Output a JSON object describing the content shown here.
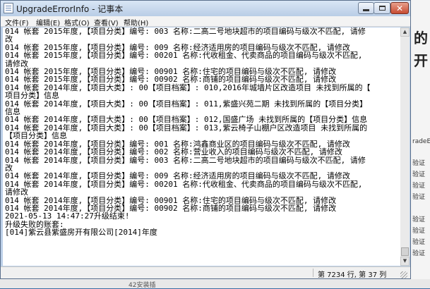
{
  "window": {
    "title": "UpgradeErrorInfo - 记事本"
  },
  "menu": [
    "文件(F)",
    "编辑(E)",
    "格式(O)",
    "查看(V)",
    "帮助(H)"
  ],
  "content_lines": [
    "014 帐套 2015年度,【项目分类】编号: 003 名称:二高二号地块超市的项目编码与级次不匹配, 请修",
    "改",
    "014 帐套 2015年度,【项目分类】编号: 009 名称:经济适用房的项目编码与级次不匹配, 请修改",
    "014 帐套 2015年度,【项目分类】编号: 00201 名称:代收租金、代卖商品的项目编码与级次不匹配,",
    "请修改",
    "014 帐套 2015年度,【项目分类】编号: 00901 名称:住宅的项目编码与级次不匹配, 请修改",
    "014 帐套 2015年度,【项目分类】编号: 00902 名称:商铺的项目编码与级次不匹配, 请修改",
    "014 帐套 2014年度,【项目大类】: 00【项目档案】: 010,2016年城墙片区改造项目 未找到所属的【",
    "项目分类】信息",
    "014 帐套 2014年度,【项目大类】: 00【项目档案】: 011,紫盛兴苑二期 未找到所属的【项目分类】",
    "信息",
    "014 帐套 2014年度,【项目大类】: 00【项目档案】: 012,国盛广场 未找到所属的【项目分类】信息",
    "014 帐套 2014年度,【项目大类】: 00【项目档案】: 013,紫云椅子山棚户区改造项目 未找到所属的",
    "【项目分类】信息",
    "014 帐套 2014年度,【项目分类】编号: 001 名称:鸿鑫商业区的项目编码与级次不匹配, 请修改",
    "014 帐套 2014年度,【项目分类】编号: 002 名称:营业收入的项目编码与级次不匹配, 请修改",
    "014 帐套 2014年度,【项目分类】编号: 003 名称:二高二号地块超市的项目编码与级次不匹配, 请修",
    "改",
    "014 帐套 2014年度,【项目分类】编号: 009 名称:经济适用房的项目编码与级次不匹配, 请修改",
    "014 帐套 2014年度,【项目分类】编号: 00201 名称:代收租金、代卖商品的项目编码与级次不匹配,",
    "请修改",
    "014 帐套 2014年度,【项目分类】编号: 00901 名称:住宅的项目编码与级次不匹配, 请修改",
    "014 帐套 2014年度,【项目分类】编号: 00902 名称:商铺的项目编码与级次不匹配, 请修改",
    "",
    "2021-05-13 14:47:27升级结束!",
    "升级失败的账套:",
    "[014]紫云县紫盛房开有限公司[2014]年度"
  ],
  "status": {
    "position": "第 7234 行, 第 37 列"
  },
  "background": {
    "right_big_1": "的",
    "right_big_2": "开",
    "right_lines": [
      "radeE",
      "验证",
      "验证",
      "验证",
      "验证",
      "验证",
      "验证",
      "验证",
      "验证"
    ],
    "bottom_text": "42安装插"
  },
  "colors": {
    "titlebar": "#c4d5ea",
    "close": "#c74b32"
  }
}
